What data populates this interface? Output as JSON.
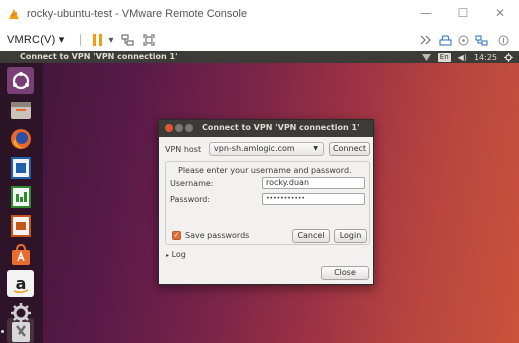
{
  "window": {
    "title": "rocky-ubuntu-test - VMware Remote Console",
    "controls": [
      "—",
      "☐",
      "✕"
    ]
  },
  "toolbar": {
    "vmrc_label": "VMRC(V)",
    "vmrc_dropdown": "▾",
    "pause_dropdown": "▾"
  },
  "panel": {
    "title": "Connect to VPN 'VPN connection 1'",
    "input_indicator": "En",
    "volume": "◀)",
    "time": "14:25"
  },
  "launcher": {
    "items": [
      "dash-icon",
      "files-icon",
      "firefox-icon",
      "writer-icon",
      "calc-icon",
      "impress-icon",
      "software-center-icon",
      "amazon-icon",
      "settings-icon",
      "system-tools-icon"
    ]
  },
  "dialog": {
    "title": "Connect to VPN 'VPN connection 1'",
    "vpn_host_label": "VPN host",
    "vpn_host_value": "vpn-sh.amlogic.com",
    "connect_label": "Connect",
    "prompt": "Please enter your username and password.",
    "username_label": "Username:",
    "username_value": "rocky.duan",
    "password_label": "Password:",
    "password_value": "•••••••••••",
    "save_passwords_label": "Save passwords",
    "save_passwords_checked": true,
    "cancel_label": "Cancel",
    "login_label": "Login",
    "log_label": "Log",
    "close_label": "Close"
  },
  "colors": {
    "accent": "#e16d3b",
    "panel": "#3c3b37",
    "dialog_bg": "#f2f1f0",
    "vmrc_pause": "#f39c12"
  }
}
